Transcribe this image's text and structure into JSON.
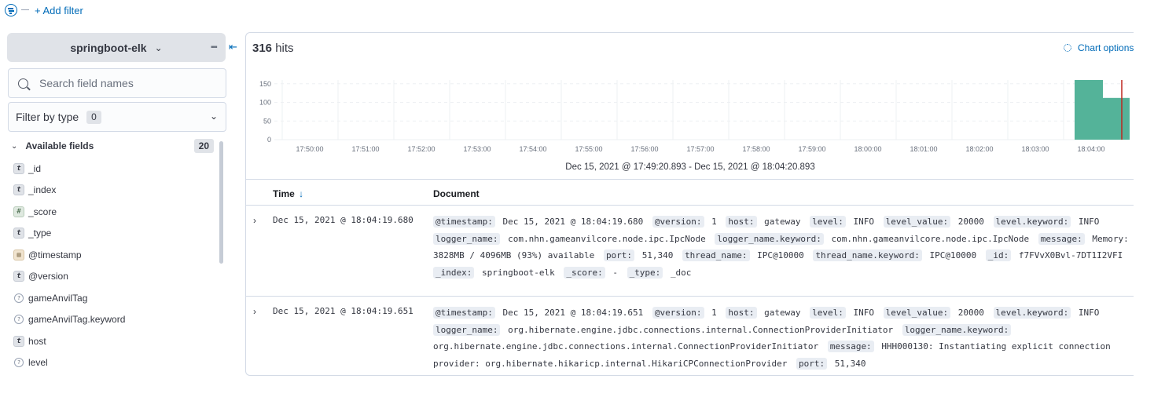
{
  "filter_bar": {
    "add_filter_label": "+ Add filter"
  },
  "sidebar": {
    "index_pattern": "springboot-elk",
    "index_chevron": "chevron-down-icon",
    "options_icon": "▪▪▪",
    "collapse_icon": "⇤",
    "search_placeholder": "Search field names",
    "filter_type_label": "Filter by type",
    "filter_type_count": "0",
    "available_fields_label": "Available fields",
    "available_fields_count": "20",
    "fields": [
      {
        "type_glyph": "t",
        "type": "string",
        "name": "_id"
      },
      {
        "type_glyph": "t",
        "type": "string",
        "name": "_index"
      },
      {
        "type_glyph": "#",
        "type": "number",
        "name": "_score"
      },
      {
        "type_glyph": "t",
        "type": "string",
        "name": "_type"
      },
      {
        "type_glyph": "▤",
        "type": "date",
        "name": "@timestamp"
      },
      {
        "type_glyph": "t",
        "type": "string",
        "name": "@version"
      },
      {
        "type_glyph": "?",
        "type": "unknown",
        "name": "gameAnvilTag"
      },
      {
        "type_glyph": "?",
        "type": "unknown",
        "name": "gameAnvilTag.keyword"
      },
      {
        "type_glyph": "t",
        "type": "string",
        "name": "host"
      },
      {
        "type_glyph": "?",
        "type": "unknown",
        "name": "level"
      }
    ]
  },
  "main": {
    "hits_count": "316",
    "hits_label": "hits",
    "chart_options_label": "Chart options",
    "time_range_label": "Dec 15, 2021 @ 17:49:20.893 - Dec 15, 2021 @ 18:04:20.893",
    "columns": {
      "time": "Time",
      "time_sort_icon": "↓",
      "document": "Document"
    },
    "rows": [
      {
        "time": "Dec 15, 2021 @ 18:04:19.680",
        "fields": [
          {
            "k": "@timestamp:",
            "v": "Dec 15, 2021 @ 18:04:19.680"
          },
          {
            "k": "@version:",
            "v": "1"
          },
          {
            "k": "host:",
            "v": "gateway"
          },
          {
            "k": "level:",
            "v": "INFO"
          },
          {
            "k": "level_value:",
            "v": "20000"
          },
          {
            "k": "level.keyword:",
            "v": "INFO"
          },
          {
            "k": "logger_name:",
            "v": "com.nhn.gameanvilcore.node.ipc.IpcNode"
          },
          {
            "k": "logger_name.keyword:",
            "v": "com.nhn.gameanvilcore.node.ipc.IpcNode"
          },
          {
            "k": "message:",
            "v": "Memory: 3828MB / 4096MB (93%) available"
          },
          {
            "k": "port:",
            "v": "51,340"
          },
          {
            "k": "thread_name:",
            "v": "IPC@10000"
          },
          {
            "k": "thread_name.keyword:",
            "v": "IPC@10000"
          },
          {
            "k": "_id:",
            "v": "f7FVvX0Bvl-7DT1I2VFI"
          },
          {
            "k": "_index:",
            "v": "springboot-elk"
          },
          {
            "k": "_score:",
            "v": "-"
          },
          {
            "k": "_type:",
            "v": "_doc"
          }
        ]
      },
      {
        "time": "Dec 15, 2021 @ 18:04:19.651",
        "fields": [
          {
            "k": "@timestamp:",
            "v": "Dec 15, 2021 @ 18:04:19.651"
          },
          {
            "k": "@version:",
            "v": "1"
          },
          {
            "k": "host:",
            "v": "gateway"
          },
          {
            "k": "level:",
            "v": "INFO"
          },
          {
            "k": "level_value:",
            "v": "20000"
          },
          {
            "k": "level.keyword:",
            "v": "INFO"
          },
          {
            "k": "logger_name:",
            "v": "org.hibernate.engine.jdbc.connections.internal.ConnectionProviderInitiator"
          },
          {
            "k": "logger_name.keyword:",
            "v": "org.hibernate.engine.jdbc.connections.internal.ConnectionProviderInitiator"
          },
          {
            "k": "message:",
            "v": "HHH000130: Instantiating explicit connection provider: org.hibernate.hikaricp.internal.HikariCPConnectionProvider"
          },
          {
            "k": "port:",
            "v": "51,340"
          }
        ]
      }
    ]
  },
  "chart_data": {
    "type": "bar",
    "title": "",
    "xlabel": "",
    "ylabel": "",
    "ylim": [
      0,
      160
    ],
    "y_ticks": [
      "150",
      "100",
      "50",
      "0"
    ],
    "x_ticks": [
      "17:50:00",
      "17:51:00",
      "17:52:00",
      "17:53:00",
      "17:54:00",
      "17:55:00",
      "17:56:00",
      "17:57:00",
      "17:58:00",
      "17:59:00",
      "18:00:00",
      "18:01:00",
      "18:02:00",
      "18:03:00",
      "18:04:00"
    ],
    "categories": [
      "18:04:00",
      "18:04:30"
    ],
    "values": [
      160,
      112
    ],
    "bar_color": "#54b399",
    "now_marker_color": "#bd271e",
    "grid": true
  },
  "colors": {
    "link": "#006bb8",
    "border": "#d3dae6",
    "tag_bg": "#e9edf3"
  }
}
